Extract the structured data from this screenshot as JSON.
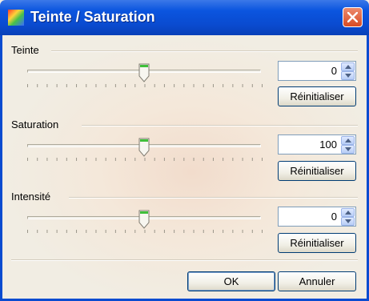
{
  "window": {
    "title": "Teinte / Saturation"
  },
  "groups": [
    {
      "label": "Teinte",
      "value": "0",
      "slider_value": 0,
      "slider_min": -180,
      "slider_max": 180,
      "reset_label": "Réinitialiser"
    },
    {
      "label": "Saturation",
      "value": "100",
      "slider_value": 100,
      "slider_min": 0,
      "slider_max": 200,
      "reset_label": "Réinitialiser"
    },
    {
      "label": "Intensité",
      "value": "0",
      "slider_value": 0,
      "slider_min": -100,
      "slider_max": 100,
      "reset_label": "Réinitialiser"
    }
  ],
  "footer": {
    "ok_label": "OK",
    "cancel_label": "Annuler"
  }
}
